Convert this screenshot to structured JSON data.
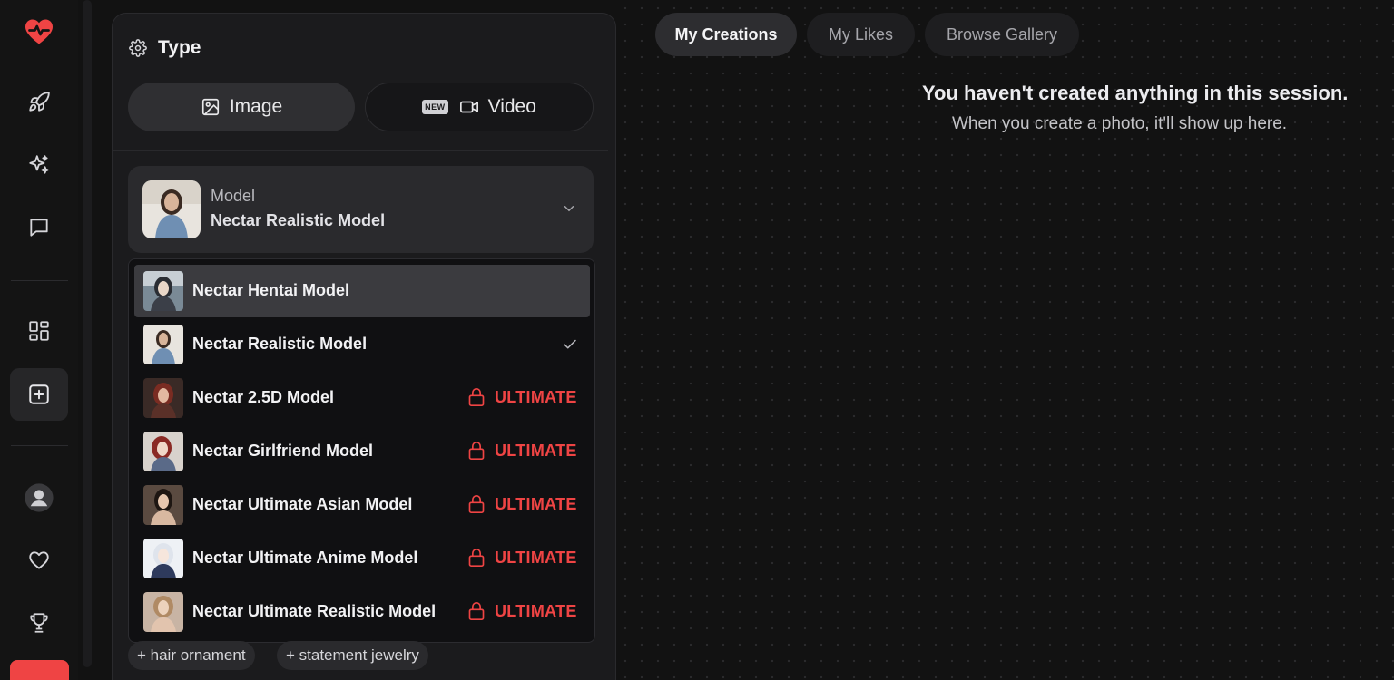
{
  "colors": {
    "accent": "#ef4444",
    "sidebar_bg": "#141414",
    "panel_bg": "#1b1b1d",
    "main_bg": "#121212"
  },
  "sidebar": {
    "items": [
      {
        "icon": "heart-pulse-icon"
      },
      {
        "icon": "rocket-icon"
      },
      {
        "icon": "sparkles-icon"
      },
      {
        "icon": "chat-icon"
      },
      {
        "icon": "grid-icon"
      },
      {
        "icon": "plus-square-icon",
        "active": true
      },
      {
        "icon": "user-icon"
      },
      {
        "icon": "heart-icon"
      },
      {
        "icon": "trophy-icon"
      }
    ]
  },
  "panel": {
    "title": "Type",
    "type_options": {
      "image": "Image",
      "video": "Video",
      "new_badge": "NEW"
    },
    "model": {
      "label": "Model",
      "value": "Nectar Realistic Model"
    },
    "dropdown": [
      {
        "name": "Nectar Hentai Model",
        "hover": true
      },
      {
        "name": "Nectar Realistic Model",
        "selected": true
      },
      {
        "name": "Nectar 2.5D Model",
        "tier": "ULTIMATE"
      },
      {
        "name": "Nectar Girlfriend Model",
        "tier": "ULTIMATE"
      },
      {
        "name": "Nectar Ultimate Asian Model",
        "tier": "ULTIMATE"
      },
      {
        "name": "Nectar Ultimate Anime Model",
        "tier": "ULTIMATE"
      },
      {
        "name": "Nectar Ultimate Realistic Model",
        "tier": "ULTIMATE"
      }
    ],
    "tags": [
      "+ hair ornament",
      "+ statement jewelry"
    ]
  },
  "tabs": {
    "my_creations": "My Creations",
    "my_likes": "My Likes",
    "browse_gallery": "Browse Gallery"
  },
  "empty_state": {
    "title": "You haven't created anything in this session.",
    "subtitle": "When you create a photo, it'll show up here."
  }
}
